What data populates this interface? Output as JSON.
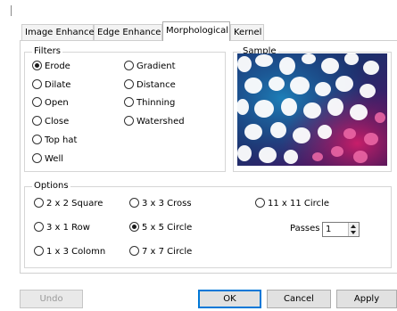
{
  "tabs": [
    "Image Enhance",
    "Edge Enhance",
    "Morphological",
    "Kernel"
  ],
  "active_tab": "Morphological",
  "filters": {
    "legend": "Filters",
    "options": [
      {
        "label": "Erode",
        "checked": true
      },
      {
        "label": "Dilate",
        "checked": false
      },
      {
        "label": "Open",
        "checked": false
      },
      {
        "label": "Close",
        "checked": false
      },
      {
        "label": "Top hat",
        "checked": false
      },
      {
        "label": "Well",
        "checked": false
      },
      {
        "label": "Gradient",
        "checked": false
      },
      {
        "label": "Distance",
        "checked": false
      },
      {
        "label": "Thinning",
        "checked": false
      },
      {
        "label": "Watershed",
        "checked": false
      }
    ]
  },
  "sample": {
    "legend": "Sample"
  },
  "options": {
    "legend": "Options",
    "kernels": [
      {
        "label": "2 x 2 Square",
        "checked": false
      },
      {
        "label": "3 x 1 Row",
        "checked": false
      },
      {
        "label": "1 x 3 Colomn",
        "checked": false
      },
      {
        "label": "3 x 3 Cross",
        "checked": false
      },
      {
        "label": "5 x 5 Circle",
        "checked": true
      },
      {
        "label": "7 x 7 Circle",
        "checked": false
      },
      {
        "label": "11 x 11 Circle",
        "checked": false
      }
    ],
    "passes_label": "Passes",
    "passes_value": "1"
  },
  "buttons": {
    "undo": "Undo",
    "ok": "OK",
    "cancel": "Cancel",
    "apply": "Apply"
  },
  "colors": {
    "accent": "#0078d7"
  }
}
